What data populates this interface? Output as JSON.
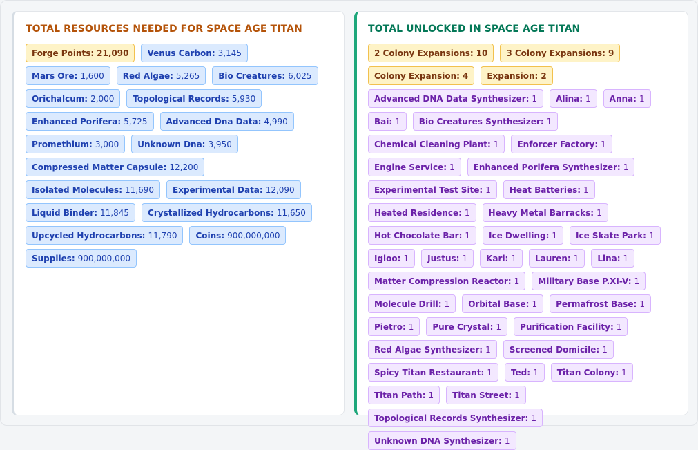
{
  "left_panel": {
    "title": "TOTAL RESOURCES NEEDED FOR SPACE AGE TITAN",
    "items": [
      {
        "name": "Forge Points:",
        "value": "21,090",
        "style": "gold"
      },
      {
        "name": "Venus Carbon:",
        "value": "3,145",
        "style": "blue"
      },
      {
        "name": "Mars Ore:",
        "value": "1,600",
        "style": "blue"
      },
      {
        "name": "Red Algae:",
        "value": "5,265",
        "style": "blue"
      },
      {
        "name": "Bio Creatures:",
        "value": "6,025",
        "style": "blue"
      },
      {
        "name": "Orichalcum:",
        "value": "2,000",
        "style": "blue"
      },
      {
        "name": "Topological Records:",
        "value": "5,930",
        "style": "blue"
      },
      {
        "name": "Enhanced Porifera:",
        "value": "5,725",
        "style": "blue"
      },
      {
        "name": "Advanced Dna Data:",
        "value": "4,990",
        "style": "blue"
      },
      {
        "name": "Promethium:",
        "value": "3,000",
        "style": "blue"
      },
      {
        "name": "Unknown Dna:",
        "value": "3,950",
        "style": "blue"
      },
      {
        "name": "Compressed Matter Capsule:",
        "value": "12,200",
        "style": "blue"
      },
      {
        "name": "Isolated Molecules:",
        "value": "11,690",
        "style": "blue"
      },
      {
        "name": "Experimental Data:",
        "value": "12,090",
        "style": "blue"
      },
      {
        "name": "Liquid Binder:",
        "value": "11,845",
        "style": "blue"
      },
      {
        "name": "Crystallized Hydrocarbons:",
        "value": "11,650",
        "style": "blue"
      },
      {
        "name": "Upcycled Hydrocarbons:",
        "value": "11,790",
        "style": "blue"
      },
      {
        "name": "Coins:",
        "value": "900,000,000",
        "style": "blue"
      },
      {
        "name": "Supplies:",
        "value": "900,000,000",
        "style": "blue"
      }
    ]
  },
  "right_panel": {
    "title": "TOTAL UNLOCKED IN SPACE AGE TITAN",
    "items": [
      {
        "name": "2 Colony Expansions:",
        "value": "10",
        "style": "gold"
      },
      {
        "name": "3 Colony Expansions:",
        "value": "9",
        "style": "gold"
      },
      {
        "name": "Colony Expansion:",
        "value": "4",
        "style": "gold"
      },
      {
        "name": "Expansion:",
        "value": "2",
        "style": "gold"
      },
      {
        "name": "Advanced DNA Data Synthesizer:",
        "value": "1",
        "style": "purple"
      },
      {
        "name": "Alina:",
        "value": "1",
        "style": "purple"
      },
      {
        "name": "Anna:",
        "value": "1",
        "style": "purple"
      },
      {
        "name": "Bai:",
        "value": "1",
        "style": "purple"
      },
      {
        "name": "Bio Creatures Synthesizer:",
        "value": "1",
        "style": "purple"
      },
      {
        "name": "Chemical Cleaning Plant:",
        "value": "1",
        "style": "purple"
      },
      {
        "name": "Enforcer Factory:",
        "value": "1",
        "style": "purple"
      },
      {
        "name": "Engine Service:",
        "value": "1",
        "style": "purple"
      },
      {
        "name": "Enhanced Porifera Synthesizer:",
        "value": "1",
        "style": "purple"
      },
      {
        "name": "Experimental Test Site:",
        "value": "1",
        "style": "purple"
      },
      {
        "name": "Heat Batteries:",
        "value": "1",
        "style": "purple"
      },
      {
        "name": "Heated Residence:",
        "value": "1",
        "style": "purple"
      },
      {
        "name": "Heavy Metal Barracks:",
        "value": "1",
        "style": "purple"
      },
      {
        "name": "Hot Chocolate Bar:",
        "value": "1",
        "style": "purple"
      },
      {
        "name": "Ice Dwelling:",
        "value": "1",
        "style": "purple"
      },
      {
        "name": "Ice Skate Park:",
        "value": "1",
        "style": "purple"
      },
      {
        "name": "Igloo:",
        "value": "1",
        "style": "purple"
      },
      {
        "name": "Justus:",
        "value": "1",
        "style": "purple"
      },
      {
        "name": "Karl:",
        "value": "1",
        "style": "purple"
      },
      {
        "name": "Lauren:",
        "value": "1",
        "style": "purple"
      },
      {
        "name": "Lina:",
        "value": "1",
        "style": "purple"
      },
      {
        "name": "Matter Compression Reactor:",
        "value": "1",
        "style": "purple"
      },
      {
        "name": "Military Base P.XI-V:",
        "value": "1",
        "style": "purple"
      },
      {
        "name": "Molecule Drill:",
        "value": "1",
        "style": "purple"
      },
      {
        "name": "Orbital Base:",
        "value": "1",
        "style": "purple"
      },
      {
        "name": "Permafrost Base:",
        "value": "1",
        "style": "purple"
      },
      {
        "name": "Pietro:",
        "value": "1",
        "style": "purple"
      },
      {
        "name": "Pure Crystal:",
        "value": "1",
        "style": "purple"
      },
      {
        "name": "Purification Facility:",
        "value": "1",
        "style": "purple"
      },
      {
        "name": "Red Algae Synthesizer:",
        "value": "1",
        "style": "purple"
      },
      {
        "name": "Screened Domicile:",
        "value": "1",
        "style": "purple"
      },
      {
        "name": "Spicy Titan Restaurant:",
        "value": "1",
        "style": "purple"
      },
      {
        "name": "Ted:",
        "value": "1",
        "style": "purple"
      },
      {
        "name": "Titan Colony:",
        "value": "1",
        "style": "purple"
      },
      {
        "name": "Titan Path:",
        "value": "1",
        "style": "purple"
      },
      {
        "name": "Titan Street:",
        "value": "1",
        "style": "purple"
      },
      {
        "name": "Topological Records Synthesizer:",
        "value": "1",
        "style": "purple"
      },
      {
        "name": "Unknown DNA Synthesizer:",
        "value": "1",
        "style": "purple"
      }
    ]
  }
}
